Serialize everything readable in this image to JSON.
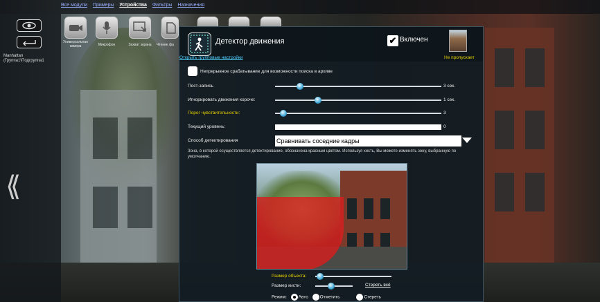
{
  "nav": {
    "items": [
      "Все модули",
      "Примеры",
      "Устройства",
      "Фильтры",
      "Назначения"
    ],
    "active_index": 2
  },
  "left": {
    "label_line1": "Manhattan",
    "label_line2": "(Группа1\\Подгруппа1"
  },
  "devices": [
    {
      "label": "Универсальная камера",
      "icon": "camera-icon"
    },
    {
      "label": "Микрофон",
      "icon": "microphone-icon"
    },
    {
      "label": "Захват экрана",
      "icon": "screen-capture-icon"
    },
    {
      "label": "Чтение фа",
      "icon": "file-read-icon"
    }
  ],
  "dialog": {
    "title": "Детектор движения",
    "enabled_label": "Включен",
    "enabled": true,
    "group_settings_link": "Открыть групповые настройки",
    "no_skip": "Не пропускает",
    "continuous_label": "Непрерывное срабатывание для возможности поиска в архиве",
    "continuous_checked": false,
    "post_record": {
      "label": "Пост-запись",
      "value": "3 сек.",
      "level": 0.15
    },
    "ignore_motion": {
      "label": "Игнорировать движения короче:",
      "value": "1 сек.",
      "level": 0.26
    },
    "sensitivity": {
      "label": "Порог чувствительности:",
      "value": "3",
      "level": 0.05
    },
    "current_level": {
      "label": "Текущий уровень:",
      "value": "0"
    },
    "method": {
      "label": "Способ детектирования",
      "selected": "Сравнивать соседние кадры"
    },
    "zone_hint": "Зона, в которой осуществляется детектирование, обозначена красным цветом. Используя кисть, Вы можете изменять зону, выбранную по умолчанию.",
    "object_size_label": "Размер объекта:",
    "brush_size_label": "Размер кисти:",
    "erase_all": "Стереть всё",
    "mode_label": "Режим:",
    "modes": [
      "Авто",
      "Отметить",
      "Стереть"
    ],
    "mode_selected": 0
  },
  "colors": {
    "link": "#4fd0ff",
    "highlight": "#e8d000",
    "zone": "#dc1e1e"
  }
}
